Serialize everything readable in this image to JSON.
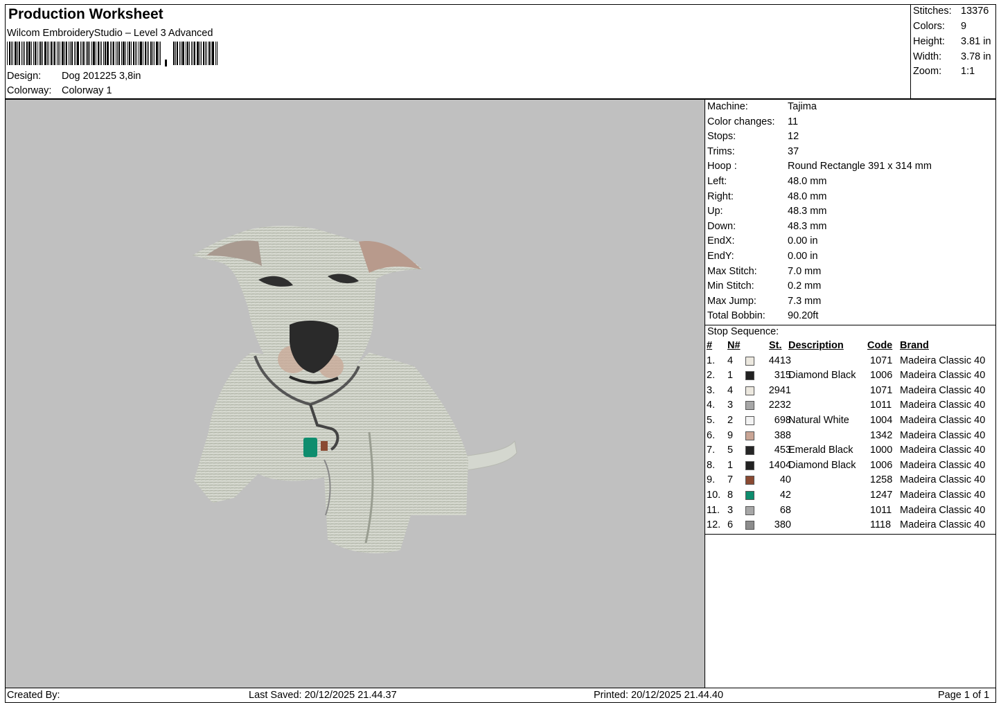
{
  "header": {
    "title": "Production Worksheet",
    "software": "Wilcom EmbroideryStudio – Level 3 Advanced",
    "design_label": "Design:",
    "design_value": "Dog 201225 3,8in",
    "colorway_label": "Colorway:",
    "colorway_value": "Colorway 1"
  },
  "summary": [
    {
      "label": "Stitches:",
      "value": "13376"
    },
    {
      "label": "Colors:",
      "value": "9"
    },
    {
      "label": "Height:",
      "value": "3.81 in"
    },
    {
      "label": "Width:",
      "value": "3.78 in"
    },
    {
      "label": "Zoom:",
      "value": "1:1"
    }
  ],
  "machine_info": [
    {
      "label": "Machine:",
      "value": "Tajima"
    },
    {
      "label": "Color changes:",
      "value": "11"
    },
    {
      "label": "Stops:",
      "value": "12"
    },
    {
      "label": "Trims:",
      "value": "37"
    },
    {
      "label": "Hoop :",
      "value": "Round Rectangle 391 x 314 mm"
    },
    {
      "label": "Left:",
      "value": "48.0 mm"
    },
    {
      "label": "Right:",
      "value": "48.0 mm"
    },
    {
      "label": "Up:",
      "value": "48.3 mm"
    },
    {
      "label": "Down:",
      "value": "48.3 mm"
    },
    {
      "label": "EndX:",
      "value": "0.00 in"
    },
    {
      "label": "EndY:",
      "value": "0.00 in"
    },
    {
      "label": "Max Stitch:",
      "value": "7.0 mm"
    },
    {
      "label": "Min Stitch:",
      "value": "0.2 mm"
    },
    {
      "label": "Max Jump:",
      "value": "7.3 mm"
    },
    {
      "label": "Total Bobbin:",
      "value": "90.20ft"
    }
  ],
  "stop_sequence": {
    "title": "Stop Sequence:",
    "headers": {
      "idx": "#",
      "needle": "N#",
      "stitches": "St.",
      "description": "Description",
      "code": "Code",
      "brand": "Brand"
    },
    "rows": [
      {
        "idx": "1.",
        "needle": "4",
        "color": "#ece8df",
        "stitches": "4413",
        "description": "",
        "code": "1071",
        "brand": "Madeira Classic 40"
      },
      {
        "idx": "2.",
        "needle": "1",
        "color": "#222222",
        "stitches": "315",
        "description": "Diamond Black",
        "code": "1006",
        "brand": "Madeira Classic 40"
      },
      {
        "idx": "3.",
        "needle": "4",
        "color": "#ece8df",
        "stitches": "2941",
        "description": "",
        "code": "1071",
        "brand": "Madeira Classic 40"
      },
      {
        "idx": "4.",
        "needle": "3",
        "color": "#a7a7a7",
        "stitches": "2232",
        "description": "",
        "code": "1011",
        "brand": "Madeira Classic 40"
      },
      {
        "idx": "5.",
        "needle": "2",
        "color": "#f3f3f3",
        "stitches": "698",
        "description": "Natural White",
        "code": "1004",
        "brand": "Madeira Classic 40"
      },
      {
        "idx": "6.",
        "needle": "9",
        "color": "#c9a595",
        "stitches": "388",
        "description": "",
        "code": "1342",
        "brand": "Madeira Classic 40"
      },
      {
        "idx": "7.",
        "needle": "5",
        "color": "#262626",
        "stitches": "453",
        "description": "Emerald Black",
        "code": "1000",
        "brand": "Madeira Classic 40"
      },
      {
        "idx": "8.",
        "needle": "1",
        "color": "#222222",
        "stitches": "1404",
        "description": "Diamond Black",
        "code": "1006",
        "brand": "Madeira Classic 40"
      },
      {
        "idx": "9.",
        "needle": "7",
        "color": "#8a4a32",
        "stitches": "40",
        "description": "",
        "code": "1258",
        "brand": "Madeira Classic 40"
      },
      {
        "idx": "10.",
        "needle": "8",
        "color": "#0e8d6e",
        "stitches": "42",
        "description": "",
        "code": "1247",
        "brand": "Madeira Classic 40"
      },
      {
        "idx": "11.",
        "needle": "3",
        "color": "#a7a7a7",
        "stitches": "68",
        "description": "",
        "code": "1011",
        "brand": "Madeira Classic 40"
      },
      {
        "idx": "12.",
        "needle": "6",
        "color": "#8c8c8c",
        "stitches": "380",
        "description": "",
        "code": "1118",
        "brand": "Madeira Classic 40"
      }
    ]
  },
  "footer": {
    "created_by": "Created By:",
    "last_saved": "Last Saved: 20/12/2025 21.44.37",
    "printed": "Printed: 20/12/2025 21.44.40",
    "page": "Page 1 of 1"
  },
  "colors": {
    "canvas_bg": "#c0c0c0",
    "body_fill": "#c9ccc2",
    "nose": "#2a2a2a"
  }
}
